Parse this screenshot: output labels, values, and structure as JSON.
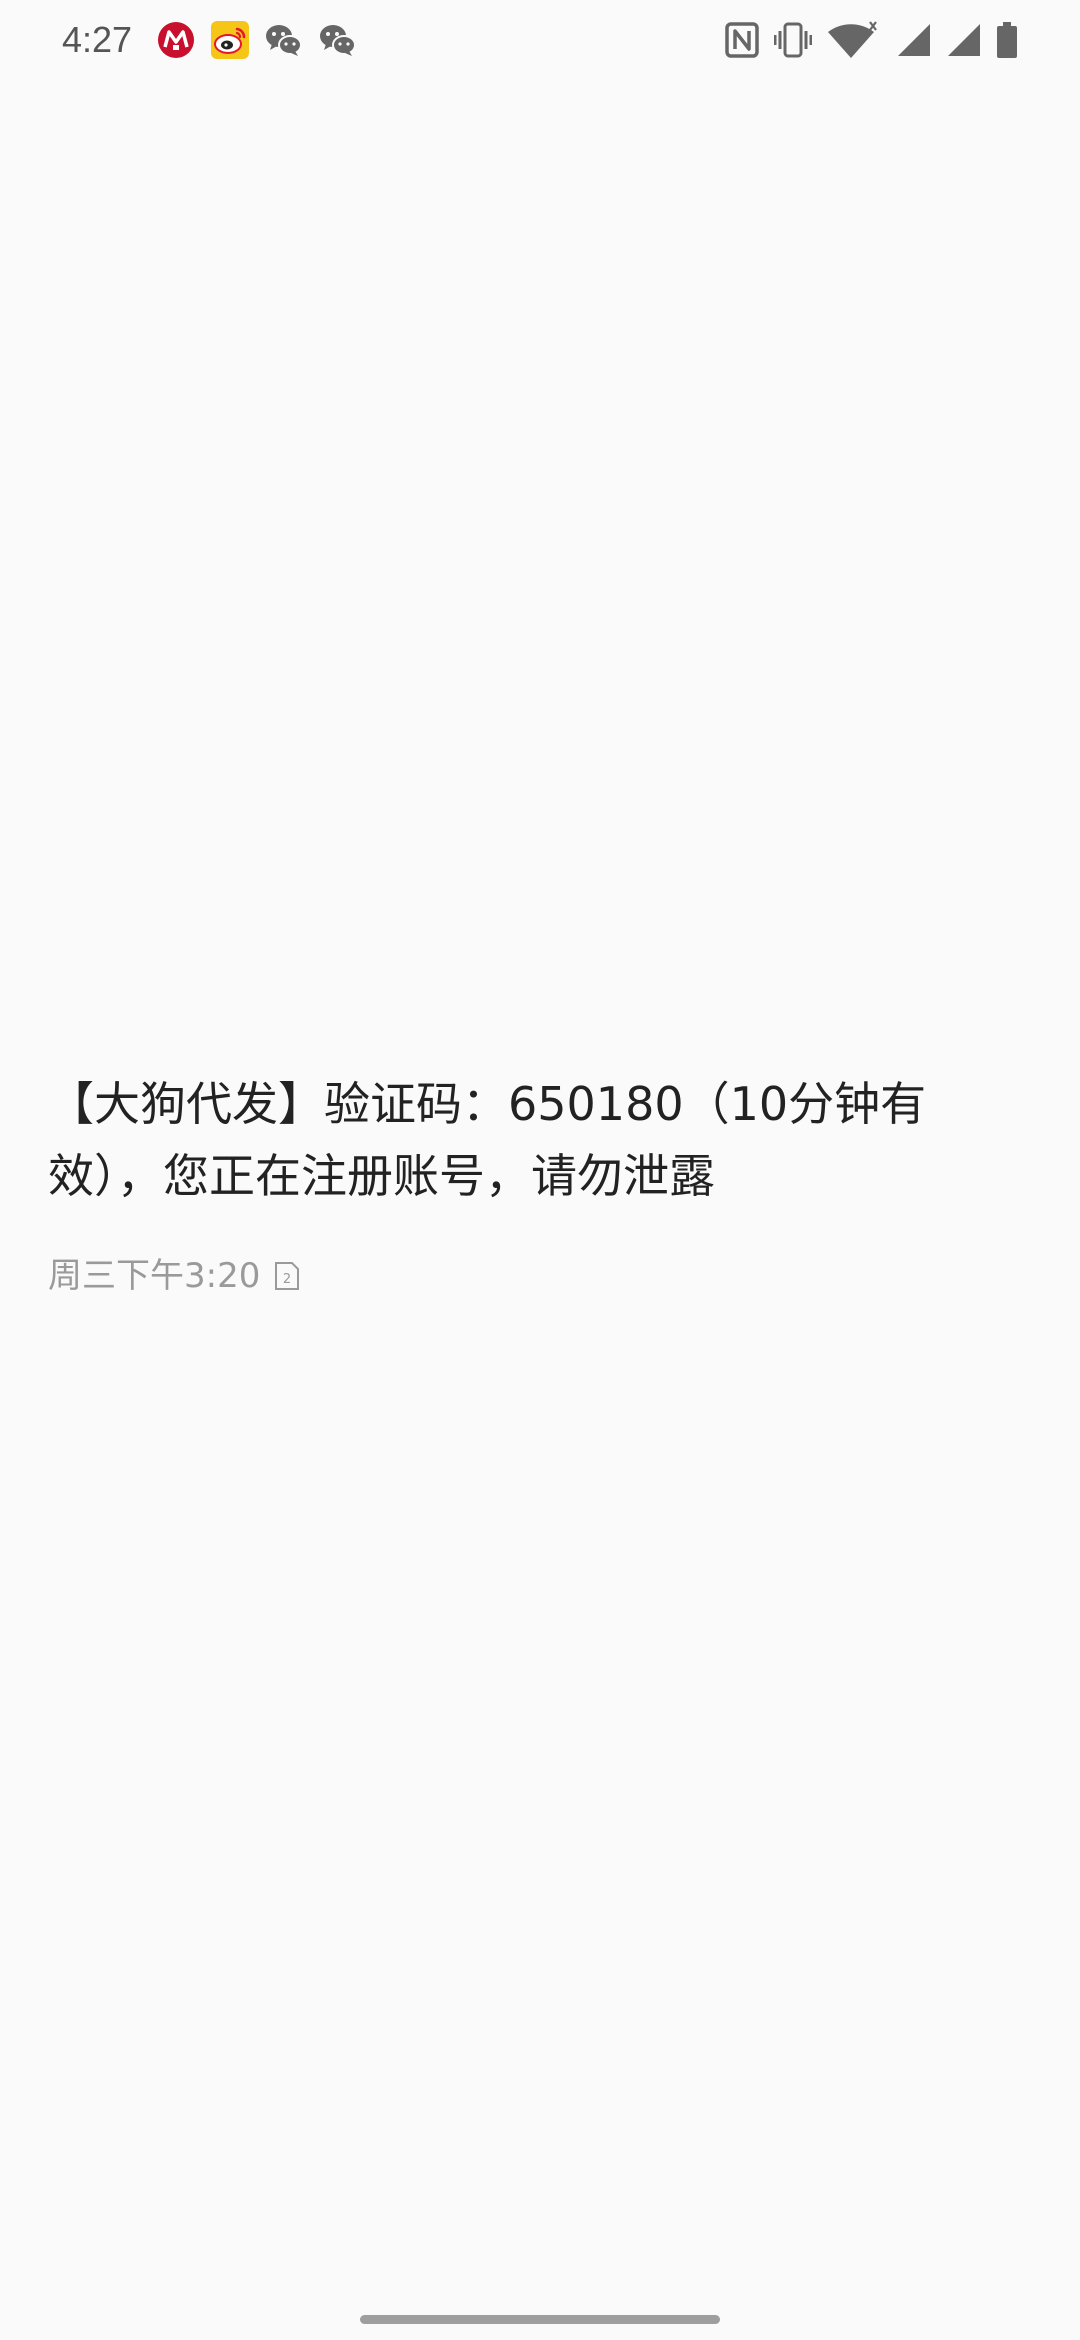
{
  "status_bar": {
    "time": "4:27",
    "notification_icons": [
      "cmb-bank-icon",
      "weibo-icon",
      "wechat-icon",
      "wechat-icon"
    ],
    "system_icons": [
      "nfc-icon",
      "vibrate-icon",
      "wifi-icon",
      "signal-icon",
      "signal-icon",
      "battery-icon"
    ]
  },
  "message": {
    "body": "【大狗代发】验证码：650180（10分钟有效），您正在注册账号，请勿泄露",
    "timestamp": "周三下午3:20",
    "sim_slot": "2"
  },
  "colors": {
    "background": "#fafafa",
    "text": "#222222",
    "meta_text": "#9a9a9a",
    "status_icons": "#666666",
    "cmb_red": "#c8102e",
    "weibo_yellow": "#f5c518",
    "weibo_red": "#e6162d"
  }
}
